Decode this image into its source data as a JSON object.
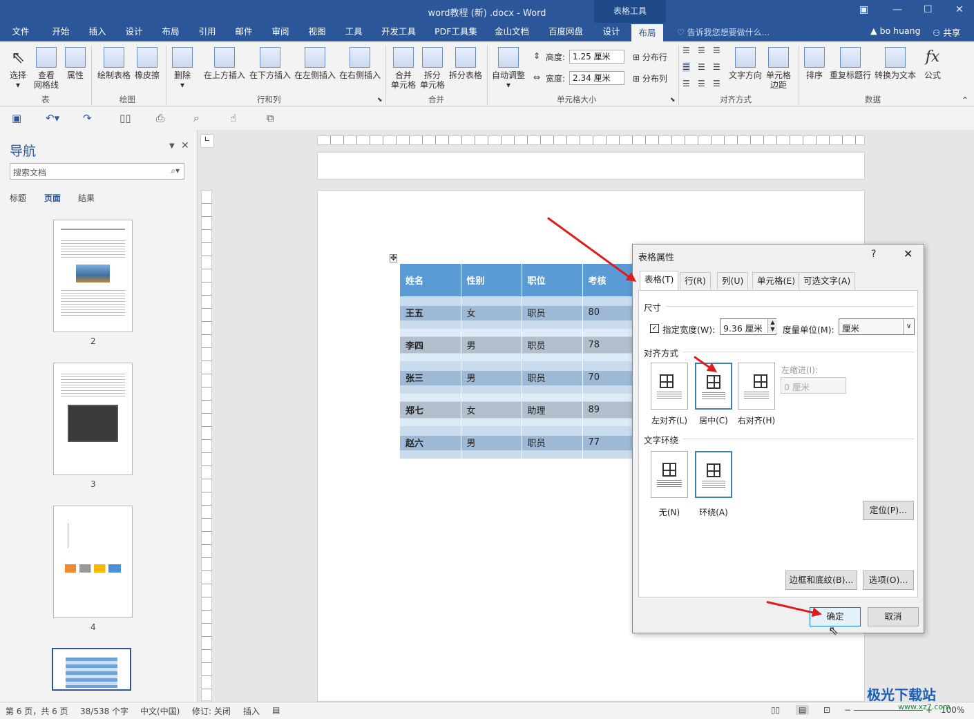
{
  "window": {
    "title": "word教程 (新) .docx - Word",
    "context_tab": "表格工具"
  },
  "tabs": [
    "文件",
    "开始",
    "插入",
    "设计",
    "布局",
    "引用",
    "邮件",
    "审阅",
    "视图",
    "工具",
    "开发工具",
    "PDF工具集",
    "金山文档",
    "百度网盘",
    "设计",
    "布局"
  ],
  "tell_me": "告诉我您想要做什么...",
  "user": "bo huang",
  "share": "共享",
  "ribbon": {
    "select": "选择",
    "view_grid_1": "查看",
    "view_grid_2": "网格线",
    "props": "属性",
    "draw_table": "绘制表格",
    "eraser": "橡皮擦",
    "delete": "删除",
    "ins_above": "在上方插入",
    "ins_below": "在下方插入",
    "ins_left": "在左侧插入",
    "ins_right": "在右侧插入",
    "merge_1": "合并",
    "merge_2": "单元格",
    "split_1": "拆分",
    "split_2": "单元格",
    "split_table": "拆分表格",
    "autofit": "自动调整",
    "height_label": "高度:",
    "height_value": "1.25 厘米",
    "width_label": "宽度:",
    "width_value": "2.34 厘米",
    "dist_rows": "分布行",
    "dist_cols": "分布列",
    "text_dir": "文字方向",
    "cell_margin_1": "单元格",
    "cell_margin_2": "边距",
    "sort": "排序",
    "repeat_header": "重复标题行",
    "to_text": "转换为文本",
    "formula": "公式",
    "groups": {
      "table": "表",
      "draw": "绘图",
      "rows_cols": "行和列",
      "merge": "合并",
      "cell_size": "单元格大小",
      "align": "对齐方式",
      "data": "数据"
    }
  },
  "nav": {
    "title": "导航",
    "search_placeholder": "搜索文档",
    "tabs": [
      "标题",
      "页面",
      "结果"
    ],
    "pages": [
      "2",
      "3",
      "4"
    ]
  },
  "table": {
    "headers": [
      "姓名",
      "性别",
      "职位",
      "考核"
    ],
    "rows": [
      [
        "王五",
        "女",
        "职员",
        "80"
      ],
      [
        "李四",
        "男",
        "职员",
        "78"
      ],
      [
        "张三",
        "男",
        "职员",
        "70"
      ],
      [
        "郑七",
        "女",
        "助理",
        "89"
      ],
      [
        "赵六",
        "男",
        "职员",
        "77"
      ]
    ]
  },
  "dialog": {
    "title": "表格属性",
    "help": "?",
    "close": "✕",
    "tabs": [
      "表格(T)",
      "行(R)",
      "列(U)",
      "单元格(E)",
      "可选文字(A)"
    ],
    "size_section": "尺寸",
    "preferred_width_label": "指定宽度(W):",
    "preferred_width_value": "9.36 厘米",
    "measure_label": "度量单位(M):",
    "measure_value": "厘米",
    "align_section": "对齐方式",
    "align_left": "左对齐(L)",
    "align_center": "居中(C)",
    "align_right": "右对齐(H)",
    "indent_label": "左缩进(I):",
    "indent_value": "0 厘米",
    "wrap_section": "文字环绕",
    "wrap_none": "无(N)",
    "wrap_around": "环绕(A)",
    "position_button": "定位(P)...",
    "borders_button": "边框和底纹(B)...",
    "options_button": "选项(O)...",
    "ok_button": "确定",
    "cancel_button": "取消"
  },
  "status": {
    "page": "第 6 页，共 6 页",
    "words": "38/538 个字",
    "lang": "中文(中国)",
    "track": "修订: 关闭",
    "insert": "插入",
    "zoom": "100%"
  },
  "watermark": {
    "name": "极光下载站",
    "url": "www.xz7.com"
  }
}
